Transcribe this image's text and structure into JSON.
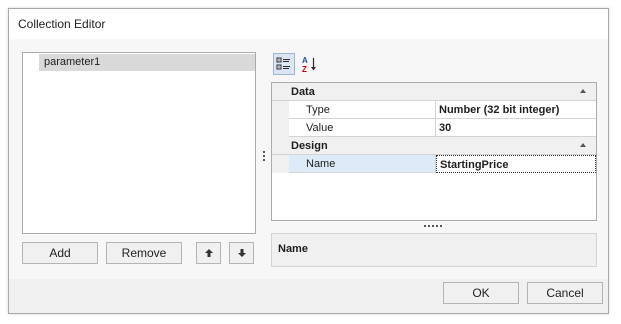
{
  "window": {
    "title": "Collection Editor"
  },
  "items": [
    {
      "label": "parameter1",
      "selected": true
    }
  ],
  "buttons": {
    "add": "Add",
    "remove": "Remove",
    "move_up_icon": "arrow-up-icon",
    "move_down_icon": "arrow-down-icon",
    "ok": "OK",
    "cancel": "Cancel"
  },
  "toolbar": {
    "categorized_icon": "categorized-view-icon",
    "categorized_active": true,
    "alphabetical_icon": "sort-az-icon",
    "alpha_top": "A",
    "alpha_bottom": "Z"
  },
  "property_grid": {
    "categories": [
      {
        "name": "Data",
        "expanded": true,
        "properties": [
          {
            "name": "Type",
            "value": "Number (32 bit integer)"
          },
          {
            "name": "Value",
            "value": "30"
          }
        ]
      },
      {
        "name": "Design",
        "expanded": true,
        "properties": [
          {
            "name": "Name",
            "value": "StartingPrice",
            "selected": true
          }
        ]
      }
    ]
  },
  "description": {
    "title": "Name"
  },
  "colors": {
    "selection": "#d9d9d9",
    "grid_selection": "#dcebf7",
    "alpha_letter": "#c00000",
    "toolbar_active": "#dbe6f4"
  }
}
